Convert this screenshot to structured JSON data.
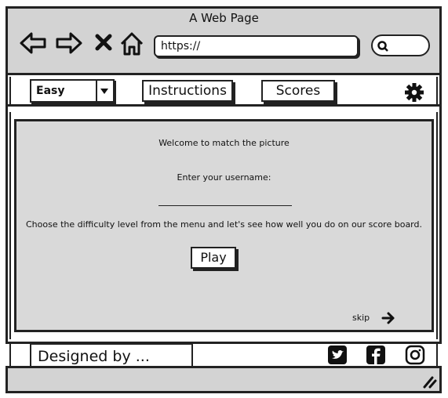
{
  "window": {
    "title": "A Web Page"
  },
  "toolbar": {
    "url": "https://",
    "icons": [
      "back-arrow-icon",
      "forward-arrow-icon",
      "close-x-icon",
      "home-icon",
      "search-icon"
    ]
  },
  "menu": {
    "difficulty": {
      "selected": "Easy"
    },
    "instructions_label": "Instructions",
    "scores_label": "Scores",
    "settings_icon": "gear-icon"
  },
  "main": {
    "welcome": "Welcome to match the picture",
    "enter_username": "Enter your username:",
    "username_value": "",
    "choose_text": "Choose the difficulty level from the menu and let's see how well you do on our score board.",
    "play_label": "Play",
    "skip_label": "skip"
  },
  "footer": {
    "designed_by": "Designed by ...",
    "social_icons": [
      "twitter-icon",
      "facebook-icon",
      "instagram-icon"
    ]
  },
  "colors": {
    "chrome": "#d3d3d3",
    "panel": "#d9d9d9",
    "ink": "#222222"
  }
}
